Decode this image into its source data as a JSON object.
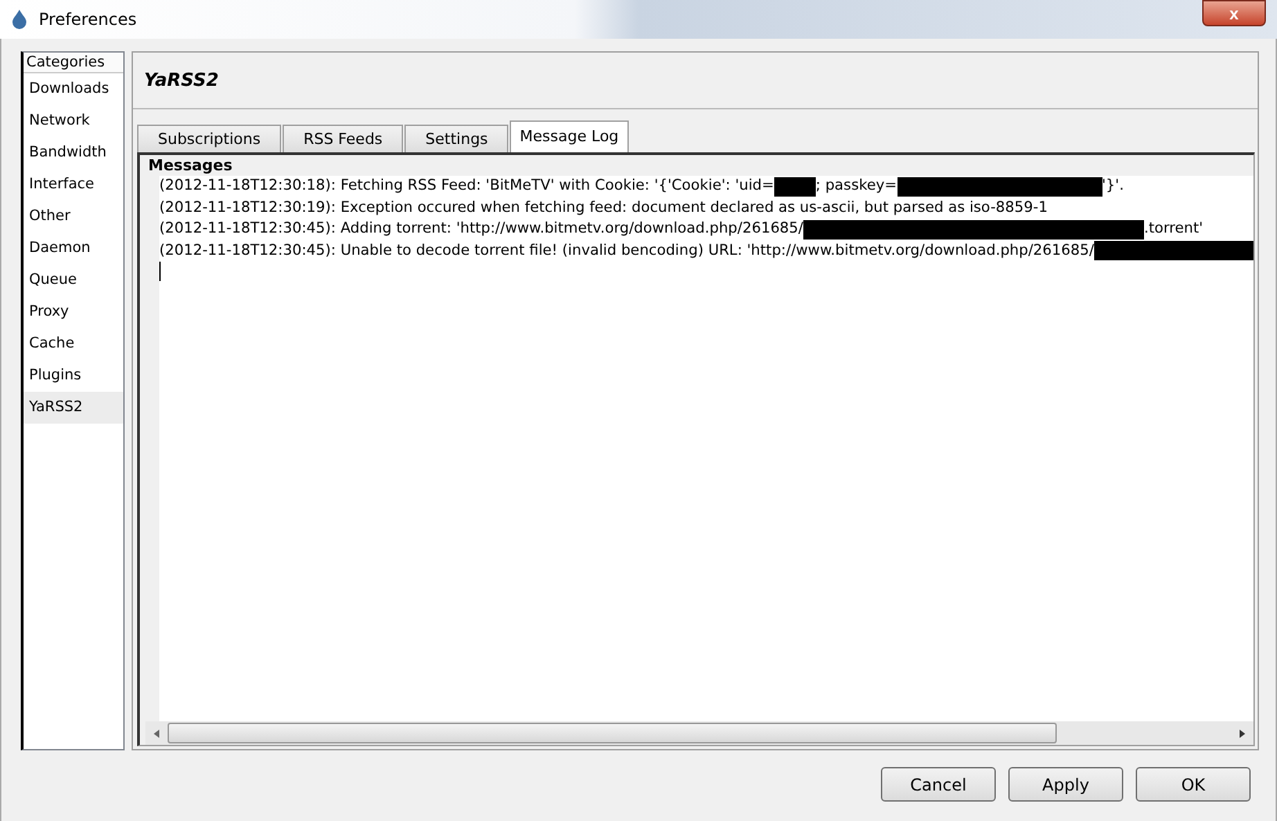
{
  "window": {
    "title": "Preferences",
    "close_label": "x"
  },
  "sidebar": {
    "heading": "Categories",
    "items": [
      {
        "label": "Downloads",
        "selected": false
      },
      {
        "label": "Network",
        "selected": false
      },
      {
        "label": "Bandwidth",
        "selected": false
      },
      {
        "label": "Interface",
        "selected": false
      },
      {
        "label": "Other",
        "selected": false
      },
      {
        "label": "Daemon",
        "selected": false
      },
      {
        "label": "Queue",
        "selected": false
      },
      {
        "label": "Proxy",
        "selected": false
      },
      {
        "label": "Cache",
        "selected": false
      },
      {
        "label": "Plugins",
        "selected": false
      },
      {
        "label": "YaRSS2",
        "selected": true
      }
    ]
  },
  "page_title": "YaRSS2",
  "tabs": [
    {
      "label": "Subscriptions",
      "selected": false
    },
    {
      "label": "RSS Feeds",
      "selected": false
    },
    {
      "label": "Settings",
      "selected": false
    },
    {
      "label": "Message Log",
      "selected": true
    }
  ],
  "messages": {
    "heading": "Messages",
    "lines": [
      [
        {
          "kind": "text",
          "text": "(2012-11-18T12:30:18): Fetching RSS Feed: 'BitMeTV' with Cookie: '{'Cookie': 'uid="
        },
        {
          "kind": "redacted_short"
        },
        {
          "kind": "text",
          "text": "; passkey="
        },
        {
          "kind": "redacted_medium"
        },
        {
          "kind": "text",
          "text": "'}'."
        }
      ],
      [
        {
          "kind": "text",
          "text": "(2012-11-18T12:30:19): Exception occured when fetching feed: document declared as us-ascii, but parsed as iso-8859-1"
        }
      ],
      [
        {
          "kind": "text",
          "text": "(2012-11-18T12:30:45): Adding torrent: 'http://www.bitmetv.org/download.php/261685/"
        },
        {
          "kind": "redacted_long"
        },
        {
          "kind": "text",
          "text": ".torrent'"
        }
      ],
      [
        {
          "kind": "text",
          "text": "(2012-11-18T12:30:45): Unable to decode torrent file! (invalid bencoding) URL: 'http://www.bitmetv.org/download.php/261685/"
        },
        {
          "kind": "redacted_fill"
        }
      ]
    ]
  },
  "buttons": [
    {
      "label": "Cancel"
    },
    {
      "label": "Apply"
    },
    {
      "label": "OK"
    }
  ]
}
